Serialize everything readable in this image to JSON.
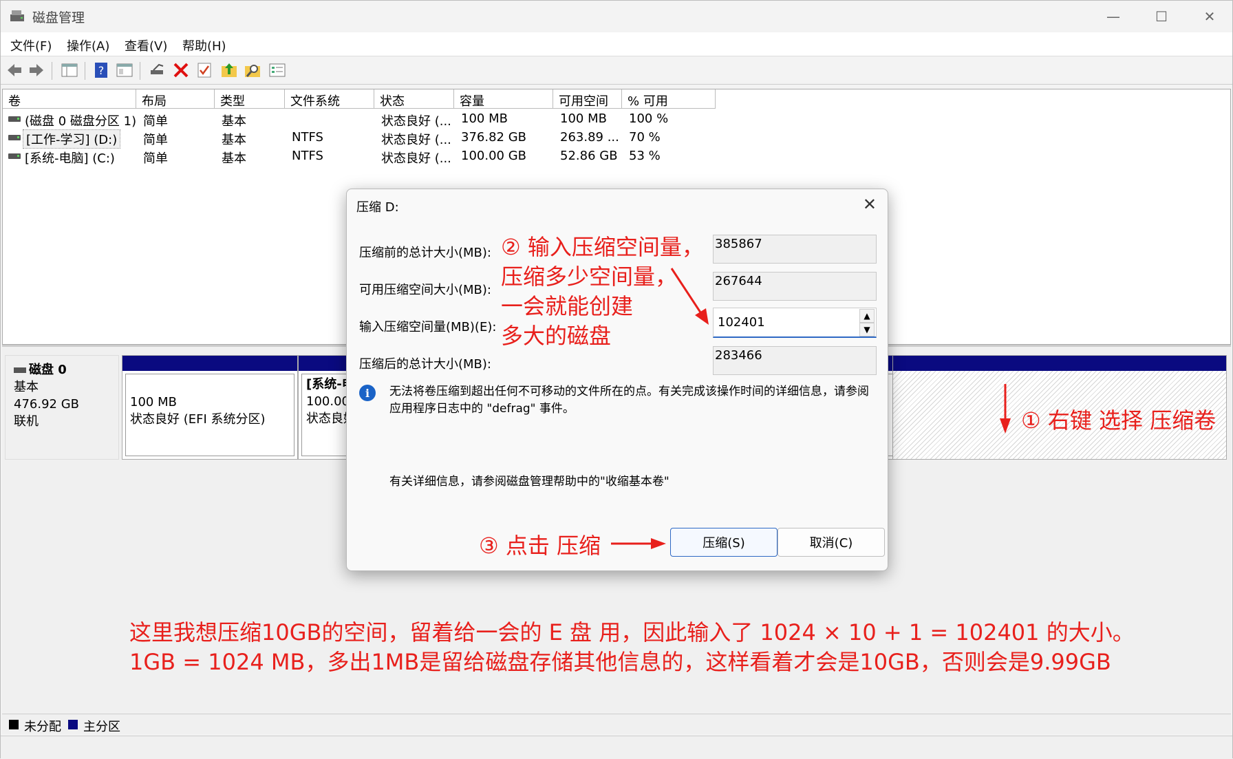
{
  "window": {
    "title": "磁盘管理"
  },
  "menu": [
    "文件(F)",
    "操作(A)",
    "查看(V)",
    "帮助(H)"
  ],
  "volume_table": {
    "columns": [
      "卷",
      "布局",
      "类型",
      "文件系统",
      "状态",
      "容量",
      "可用空间",
      "% 可用"
    ],
    "rows": [
      [
        "(磁盘 0 磁盘分区 1)",
        "简单",
        "基本",
        "",
        "状态良好 (...",
        "100 MB",
        "100 MB",
        "100 %"
      ],
      [
        "[工作-学习] (D:)",
        "简单",
        "基本",
        "NTFS",
        "状态良好 (...",
        "376.82 GB",
        "263.89 ...",
        "70 %"
      ],
      [
        "[系统-电脑] (C:)",
        "简单",
        "基本",
        "NTFS",
        "状态良好 (...",
        "100.00 GB",
        "52.86 GB",
        "53 %"
      ]
    ]
  },
  "disk": {
    "name": "磁盘 0",
    "type": "基本",
    "size": "476.92 GB",
    "state": "联机",
    "partitions": [
      {
        "line1": "100 MB",
        "line2": "状态良好 (EFI 系统分区)"
      },
      {
        "line0": "[系统-电",
        "line1": "100.00",
        "line2": "状态良好"
      }
    ]
  },
  "legend": {
    "unallocated": "未分配",
    "primary": "主分区"
  },
  "dialog": {
    "title": "压缩 D:",
    "label_total_before": "压缩前的总计大小(MB):",
    "value_total_before": "385867",
    "label_available": "可用压缩空间大小(MB):",
    "value_available": "267644",
    "label_input": "输入压缩空间量(MB)(E):",
    "value_input": "102401",
    "label_total_after": "压缩后的总计大小(MB):",
    "value_total_after": "283466",
    "info": "无法将卷压缩到超出任何不可移动的文件所在的点。有关完成该操作时间的详细信息，请参阅应用程序日志中的 \"defrag\" 事件。",
    "help": "有关详细信息，请参阅磁盘管理帮助中的\"收缩基本卷\"",
    "shrink_button": "压缩(S)",
    "cancel_button": "取消(C)"
  },
  "annotations": {
    "step1": "① 右键 选择 压缩卷",
    "step2_lines": [
      "② 输入压缩空间量，",
      "压缩多少空间量，",
      "一会就能创建",
      "多大的磁盘"
    ],
    "step3": "③ 点击 压缩",
    "note_lines": [
      "这里我想压缩10GB的空间，留着给一会的 E 盘 用，因此输入了 1024 × 10 + 1 = 102401 的大小。",
      "1GB = 1024 MB，多出1MB是留给磁盘存储其他信息的，这样看着才会是10GB，否则会是9.99GB"
    ],
    "color": "#e8201c"
  },
  "colors": {
    "partition_bar": "#0a0a80",
    "accent": "#2d68c4"
  }
}
